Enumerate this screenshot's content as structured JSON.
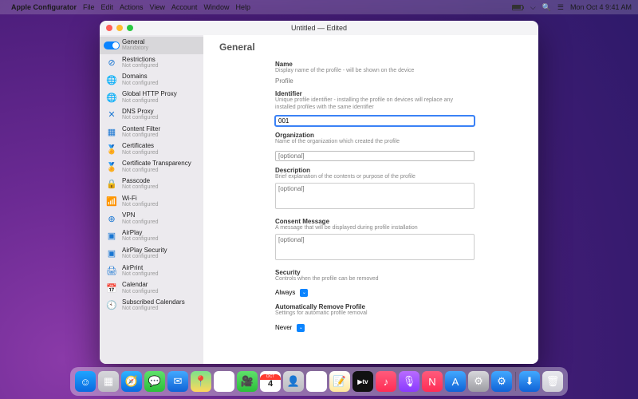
{
  "menubar": {
    "app_name": "Apple Configurator",
    "items": [
      "File",
      "Edit",
      "Actions",
      "View",
      "Account",
      "Window",
      "Help"
    ],
    "clock": "Mon Oct 4  9:41 AM"
  },
  "window": {
    "title": "Untitled — Edited"
  },
  "sidebar": {
    "not_configured": "Not configured",
    "items": [
      {
        "label": "General",
        "sub": "Mandatory",
        "icon": "toggle",
        "selected": true
      },
      {
        "label": "Restrictions",
        "icon": "⊘"
      },
      {
        "label": "Domains",
        "icon": "🌐"
      },
      {
        "label": "Global HTTP Proxy",
        "icon": "🌐"
      },
      {
        "label": "DNS Proxy",
        "icon": "✕"
      },
      {
        "label": "Content Filter",
        "icon": "▦"
      },
      {
        "label": "Certificates",
        "icon": "🏅"
      },
      {
        "label": "Certificate Transparency",
        "icon": "🏅"
      },
      {
        "label": "Passcode",
        "icon": "🔒"
      },
      {
        "label": "Wi-Fi",
        "icon": "📶"
      },
      {
        "label": "VPN",
        "icon": "⊕"
      },
      {
        "label": "AirPlay",
        "icon": "▣"
      },
      {
        "label": "AirPlay Security",
        "icon": "▣"
      },
      {
        "label": "AirPrint",
        "icon": "🖨"
      },
      {
        "label": "Calendar",
        "icon": "📅"
      },
      {
        "label": "Subscribed Calendars",
        "icon": "🕙"
      }
    ]
  },
  "main": {
    "heading": "General",
    "name": {
      "label": "Name",
      "desc": "Display name of the profile - will be shown on the device",
      "value": "Profile"
    },
    "identifier": {
      "label": "Identifier",
      "desc": "Unique profile identifier - installing the profile on devices will replace any installed profiles with the same identifier",
      "value": "001"
    },
    "organization": {
      "label": "Organization",
      "desc": "Name of the organization which created the profile",
      "placeholder": "[optional]"
    },
    "description": {
      "label": "Description",
      "desc": "Brief explanation of the contents or purpose of the profile",
      "placeholder": "[optional]"
    },
    "consent": {
      "label": "Consent Message",
      "desc": "A message that will be displayed during profile installation",
      "placeholder": "[optional]"
    },
    "security": {
      "label": "Security",
      "desc": "Controls when the profile can be removed",
      "value": "Always"
    },
    "auto_remove": {
      "label": "Automatically Remove Profile",
      "desc": "Settings for automatic profile removal",
      "value": "Never"
    }
  },
  "dock": {
    "calendar": {
      "month": "OCT",
      "day": "4"
    },
    "apps": [
      {
        "name": "finder",
        "color": "linear-gradient(#1ea4ff,#0a6adf)",
        "glyph": "☺"
      },
      {
        "name": "launchpad",
        "color": "linear-gradient(#d7d7db,#bcbcc2)",
        "glyph": "▦"
      },
      {
        "name": "safari",
        "color": "linear-gradient(#2fb4ff,#0a6adf)",
        "glyph": "🧭"
      },
      {
        "name": "messages",
        "color": "linear-gradient(#5fe06b,#2bbf3a)",
        "glyph": "💬"
      },
      {
        "name": "mail",
        "color": "linear-gradient(#42a8ff,#1063d6)",
        "glyph": "✉"
      },
      {
        "name": "maps",
        "color": "linear-gradient(#7ce28a,#ffd85c)",
        "glyph": "📍"
      },
      {
        "name": "photos",
        "color": "#fff",
        "glyph": "✿"
      },
      {
        "name": "facetime",
        "color": "linear-gradient(#5fe06b,#2bbf3a)",
        "glyph": "🎥"
      },
      {
        "name": "calendar",
        "color": "#fff",
        "glyph": ""
      },
      {
        "name": "contacts",
        "color": "linear-gradient(#d7d7db,#bcbcc2)",
        "glyph": "👤"
      },
      {
        "name": "reminders",
        "color": "#fff",
        "glyph": "☰"
      },
      {
        "name": "notes",
        "color": "linear-gradient(#fff,#ffe89a)",
        "glyph": "📝"
      },
      {
        "name": "tv",
        "color": "#111",
        "glyph": "tv"
      },
      {
        "name": "music",
        "color": "linear-gradient(#ff5b7c,#ff2d55)",
        "glyph": "♪"
      },
      {
        "name": "podcasts",
        "color": "linear-gradient(#b86cff,#8a3aff)",
        "glyph": "🎙"
      },
      {
        "name": "news",
        "color": "linear-gradient(#ff5b7c,#ff2d55)",
        "glyph": "N"
      },
      {
        "name": "appstore",
        "color": "linear-gradient(#42a8ff,#1063d6)",
        "glyph": "A"
      },
      {
        "name": "preferences",
        "color": "linear-gradient(#d7d7db,#9c9ca2)",
        "glyph": "⚙"
      },
      {
        "name": "configurator",
        "color": "linear-gradient(#42a8ff,#1063d6)",
        "glyph": "⚙"
      }
    ],
    "tray": [
      {
        "name": "downloads",
        "color": "linear-gradient(#42a8ff,#1063d6)",
        "glyph": "⬇"
      },
      {
        "name": "trash",
        "color": "linear-gradient(#e9e9ee,#cfcfd6)",
        "glyph": "🗑"
      }
    ]
  }
}
